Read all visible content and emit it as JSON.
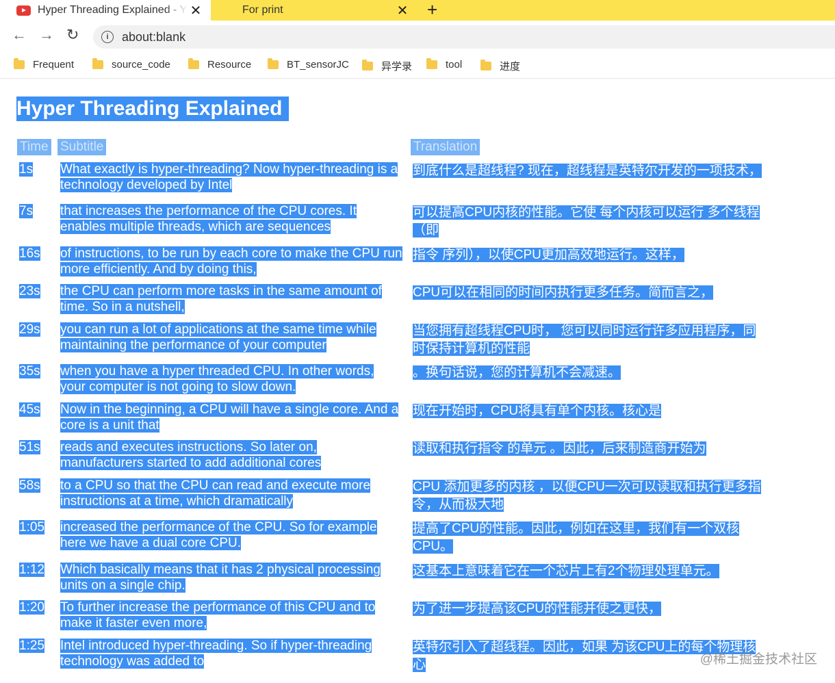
{
  "browser": {
    "tabs": [
      {
        "title": "Hyper Threading Explained - Y",
        "active": true
      },
      {
        "title": "For print",
        "active": false
      }
    ],
    "new_tab": "+",
    "url": "about:blank",
    "bookmarks": [
      "Frequent",
      "source_code",
      "Resource",
      "BT_sensorJC",
      "异学录",
      "tool",
      "进度"
    ]
  },
  "page": {
    "title": "Hyper Threading Explained",
    "headers": {
      "time": "Time",
      "subtitle": "Subtitle",
      "translation": "Translation"
    },
    "rows": [
      {
        "time": "1s",
        "sub": "What exactly is hyper-threading? Now  hyper-threading is a technology developed by Intel ",
        "tr": "到底什么是超线程? 现在，超线程是英特尔开发的一项技术，"
      },
      {
        "time": "7s",
        "sub": "that increases the performance of the CPU cores. It enables multiple threads, which are sequences ",
        "tr": "可以提高CPU内核的性能。它使 每个内核可以运行 多个线程（即"
      },
      {
        "time": "16s",
        "sub": "of instructions, to be run by each core to make  the CPU run more efficiently. And by doing this, ",
        "tr": "指令 序列），以使CPU更加高效地运行。这样，"
      },
      {
        "time": "23s",
        "sub": "the CPU can perform more tasks in the  same amount of time. So in a nutshell, ",
        "tr": "CPU可以在相同的时间内执行更多任务。简而言之，"
      },
      {
        "time": "29s",
        "sub": "you can run a lot of applications at the same time  while maintaining the performance of your computer ",
        "tr": "当您拥有超线程CPU时， 您可以同时运行许多应用程序，同时保持计算机的性能"
      },
      {
        "time": "35s",
        "sub": "when you have a hyper threaded CPU. In other  words, your computer is not going to slow down.",
        "tr": "。换句话说，您的计算机不会减速。"
      },
      {
        "time": "45s",
        "sub": "Now in the beginning, a CPU will have  a single core. And a core is a unit that ",
        "tr": "现在开始时，CPU将具有单个内核。核心是"
      },
      {
        "time": "51s",
        "sub": "reads and executes instructions. So later on, manufacturers started to add additional cores ",
        "tr": "读取和执行指令 的单元 。因此，后来制造商开始为"
      },
      {
        "time": "58s",
        "sub": "to a CPU so that the CPU can read and execute  more instructions at a time, which dramatically ",
        "tr": "CPU 添加更多的内核 ，以便CPU一次可以读取和执行更多指令，从而极大地"
      },
      {
        "time": "1:05",
        "sub": "increased the performance of the CPU. So  for example here we have a dual core CPU.",
        "tr": "提高了CPU的性能。因此，例如在这里，我们有一个双核CPU。"
      },
      {
        "time": "1:12",
        "sub": "Which basically means that it has 2  physical processing units on a single chip.",
        "tr": "这基本上意味着它在一个芯片上有2个物理处理单元。"
      },
      {
        "time": "1:20",
        "sub": "To further increase the performance of  this CPU and to make it faster even more,",
        "tr": "为了进一步提高该CPU的性能并使之更快，"
      },
      {
        "time": "1:25",
        "sub": "Intel introduced hyper-threading. So if  hyper-threading technology was added to ",
        "tr": "英特尔引入了超线程。因此，如果 为该CPU上的每个物理核心"
      }
    ]
  },
  "watermark": "@稀土掘金技术社区"
}
